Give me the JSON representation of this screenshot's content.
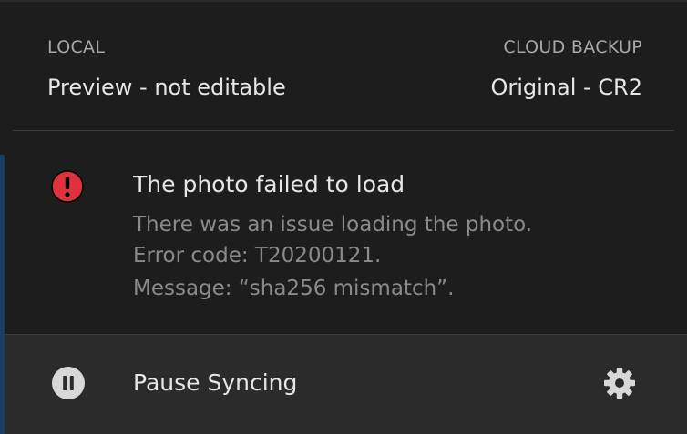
{
  "sources": {
    "local": {
      "label": "LOCAL",
      "value": "Preview - not editable"
    },
    "cloud": {
      "label": "CLOUD BACKUP",
      "value": "Original - CR2"
    }
  },
  "error": {
    "icon": "error-icon",
    "color": "#e0323c",
    "title": "The photo failed to load",
    "lines": [
      "There was an issue loading the photo.",
      "Error code: T20200121.",
      "Message: “sha256 mismatch”."
    ]
  },
  "footer": {
    "pause_icon": "pause-icon",
    "pause_label": "Pause Syncing",
    "settings_icon": "gear-icon"
  }
}
